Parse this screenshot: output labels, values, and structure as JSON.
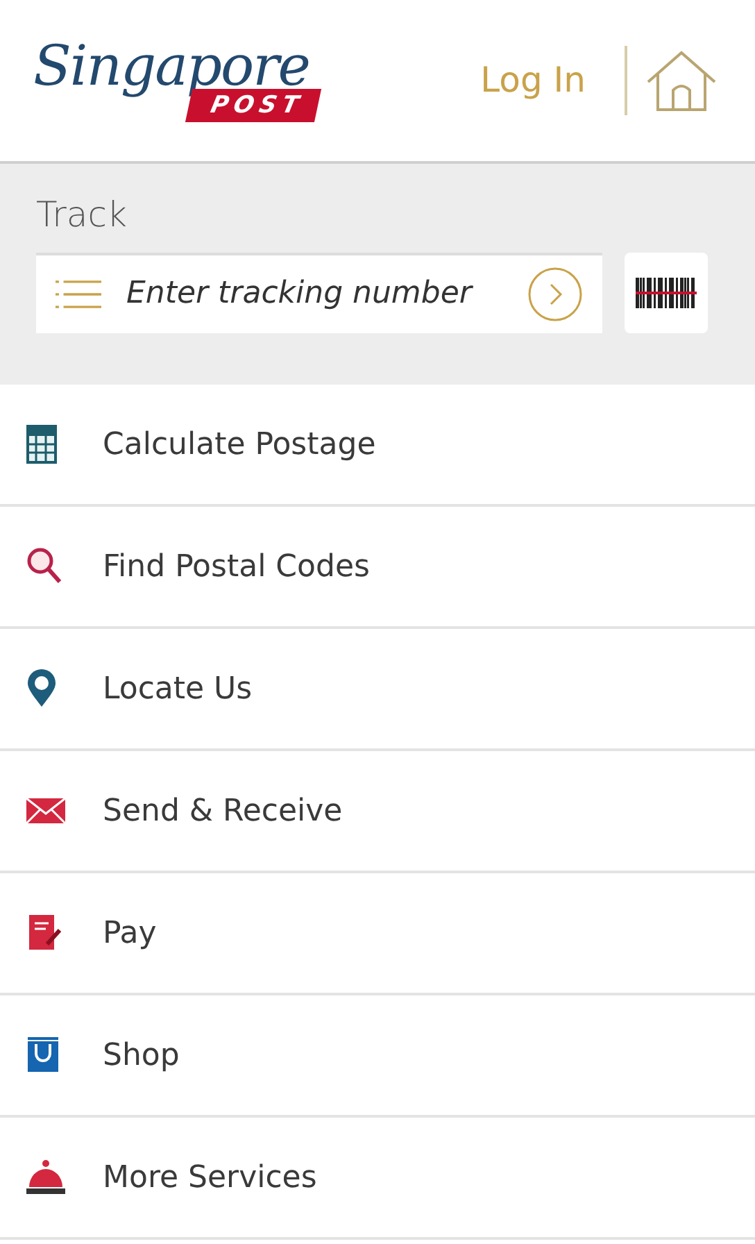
{
  "header": {
    "logo": {
      "script": "Singapore",
      "badge": "POST"
    },
    "login": "Log In"
  },
  "track": {
    "title": "Track",
    "placeholder": "Enter tracking number"
  },
  "menu": [
    {
      "kind": "calculator",
      "label": "Calculate Postage"
    },
    {
      "kind": "search",
      "label": "Find Postal Codes"
    },
    {
      "kind": "pin",
      "label": "Locate Us"
    },
    {
      "kind": "envelope",
      "label": "Send & Receive"
    },
    {
      "kind": "bill",
      "label": "Pay"
    },
    {
      "kind": "bag",
      "label": "Shop"
    },
    {
      "kind": "bell",
      "label": "More Services"
    }
  ]
}
